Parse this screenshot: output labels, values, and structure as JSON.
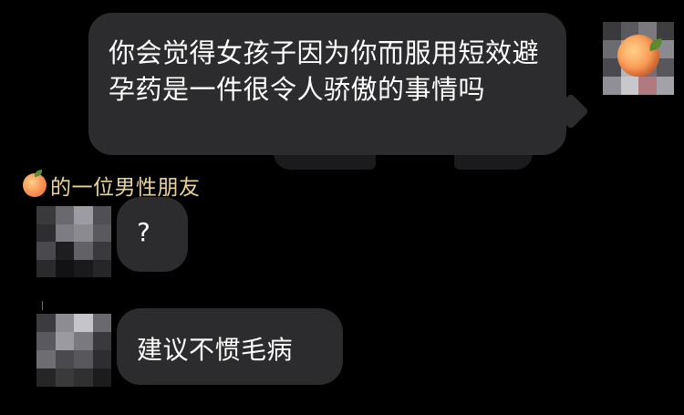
{
  "messages": {
    "outgoing_text": "你会觉得女孩子因为你而服用短效避孕药是一件很令人骄傲的事情吗",
    "sender_label": "的一位男性朋友",
    "reply_1": "?",
    "reply_2": "建议不惯毛病"
  },
  "icons": {
    "self_avatar": "peach-emoji-avatar",
    "sender_badge": "peach-emoji"
  },
  "colors": {
    "background": "#000000",
    "bubble": "#2c2c2e",
    "sender_name": "#e9d398",
    "text": "#ffffff"
  }
}
